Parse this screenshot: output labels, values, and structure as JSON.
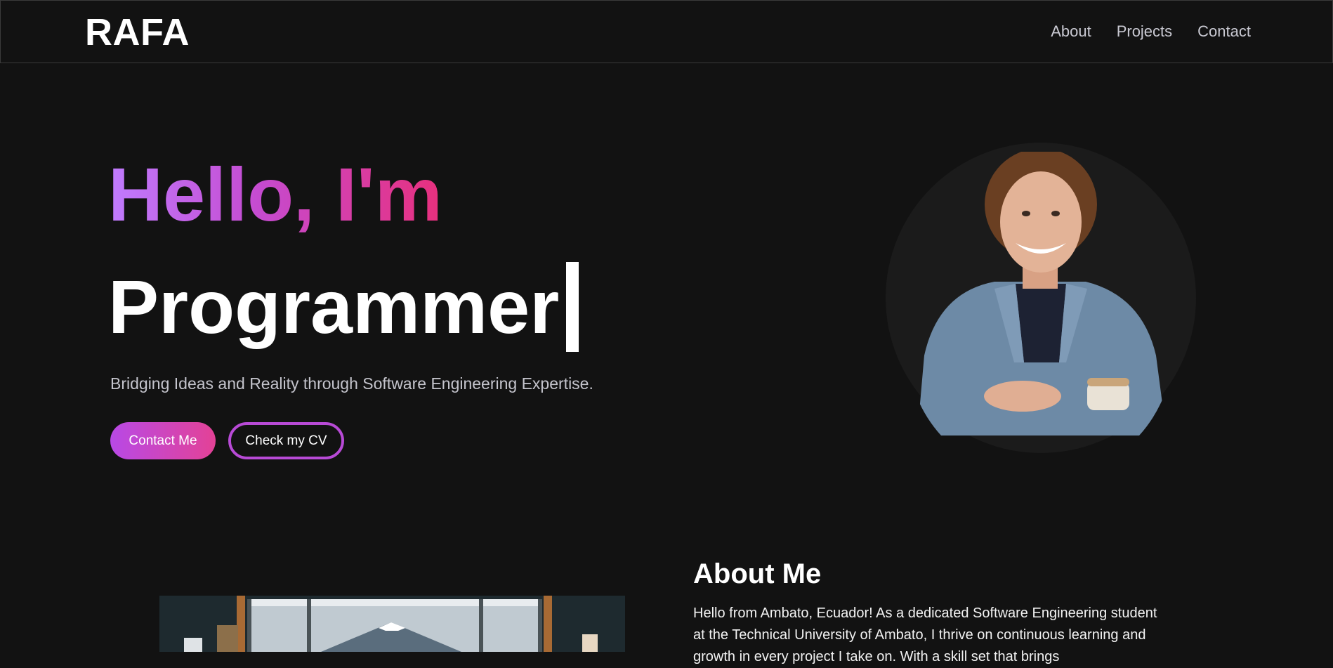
{
  "navbar": {
    "logo": "RAFA",
    "links": [
      "About",
      "Projects",
      "Contact"
    ]
  },
  "hero": {
    "greeting": "Hello, I'm",
    "role": "Programmer",
    "cursor": "|",
    "tagline": "Bridging Ideas and Reality through Software Engineering Expertise.",
    "primary_button": "Contact Me",
    "secondary_button": "Check my CV"
  },
  "about": {
    "title": "About Me",
    "text": "Hello from Ambato, Ecuador! As a dedicated Software Engineering student at the Technical University of Ambato, I thrive on continuous learning and growth in every project I take on. With a skill set that brings"
  },
  "colors": {
    "background": "#121212",
    "accent_purple": "#b849e6",
    "accent_pink": "#e34296",
    "nav_text": "#c9c9d2"
  },
  "icons": {
    "avatar": "profile-photo",
    "about_image": "mountain-window-illustration"
  }
}
